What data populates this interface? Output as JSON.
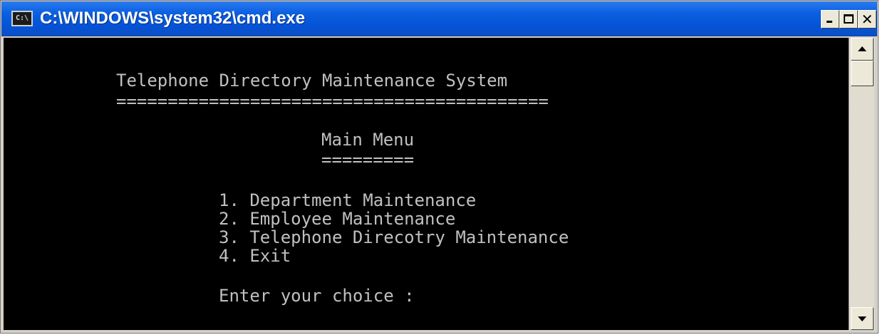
{
  "window": {
    "title": "C:\\WINDOWS\\system32\\cmd.exe",
    "icon": "cmd-icon",
    "icon_text": "C:\\",
    "controls": {
      "minimize": "minimize-icon",
      "maximize": "maximize-icon",
      "close": "close-icon",
      "close_glyph": "✕"
    }
  },
  "console": {
    "title": "Telephone Directory Maintenance System",
    "title_rule": "==========================================",
    "menu_heading": "Main Menu",
    "menu_rule": "=========",
    "options": [
      "1. Department Maintenance",
      "2. Employee Maintenance",
      "3. Telephone Direcotry Maintenance",
      "4. Exit"
    ],
    "prompt": "Enter your choice :"
  },
  "colors": {
    "titlebar": "#0553d6",
    "console_bg": "#000000",
    "console_text": "#c0c0c0"
  }
}
